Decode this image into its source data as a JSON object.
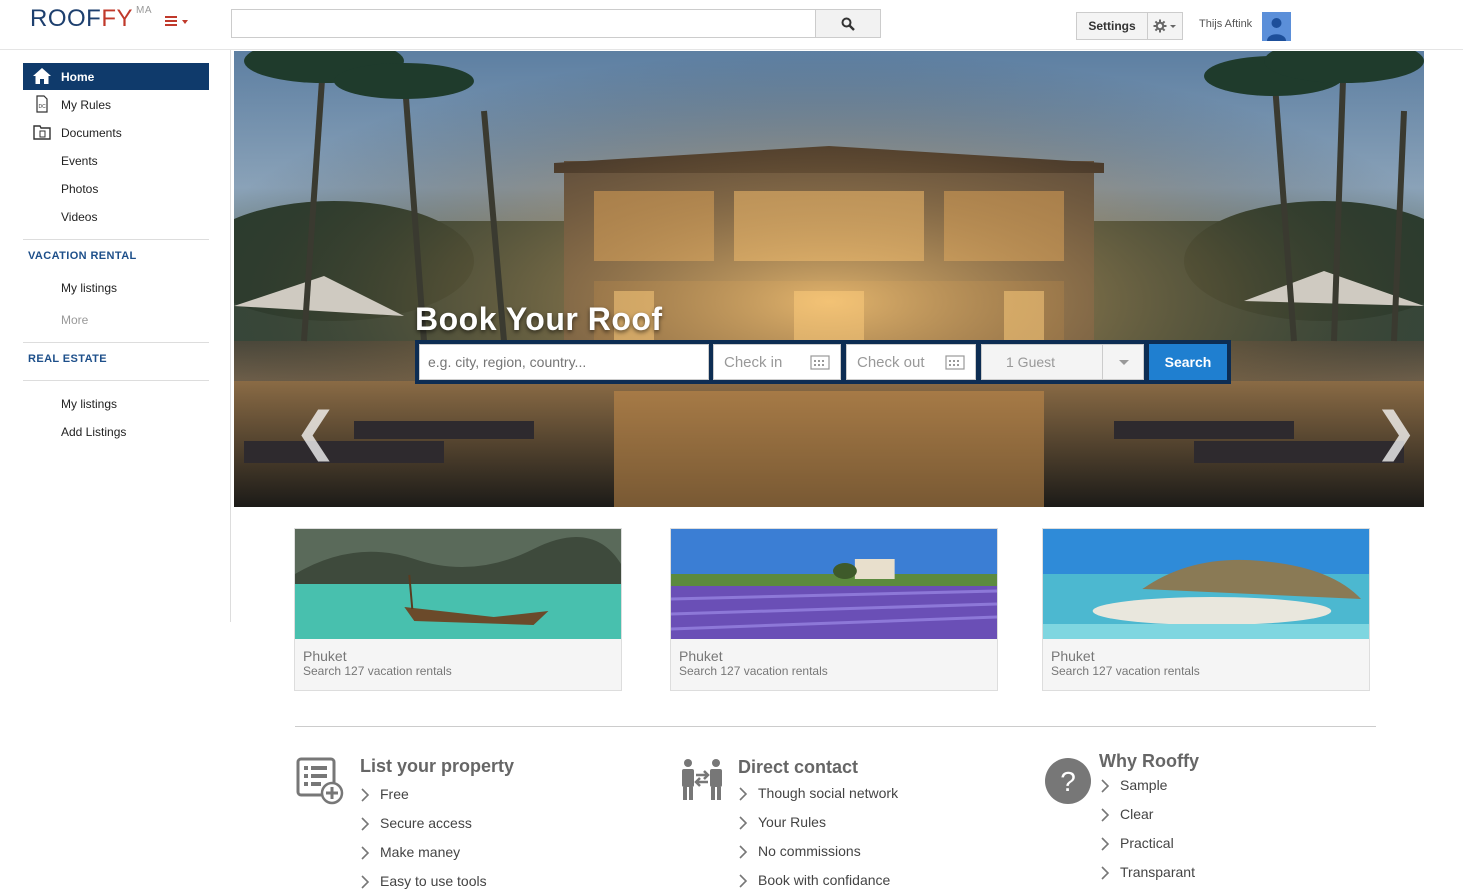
{
  "header": {
    "logo_part1": "ROOF",
    "logo_part2": "FY",
    "logo_suffix": "MA",
    "search_placeholder": "",
    "settings_label": "Settings",
    "user_name": "Thijs Aftink"
  },
  "sidebar": {
    "items": [
      {
        "label": "Home",
        "icon": "home-icon",
        "active": true
      },
      {
        "label": "My Rules",
        "icon": "document-icon"
      },
      {
        "label": "Documents",
        "icon": "folder-icon"
      },
      {
        "label": "Events"
      },
      {
        "label": "Photos"
      },
      {
        "label": "Videos"
      }
    ],
    "vacation_title": "VACATION RENTAL",
    "vacation_items": [
      "My listings",
      "More"
    ],
    "realestate_title": "REAL ESTATE",
    "realestate_items": [
      "My listings",
      "Add Listings"
    ]
  },
  "hero": {
    "title": "Book Your Roof",
    "destination_placeholder": "e.g. city, region, country...",
    "checkin_label": "Check in",
    "checkout_label": "Check out",
    "guests_label": "1 Guest",
    "search_label": "Search",
    "prev_arrow": "❮",
    "next_arrow": "❯"
  },
  "cards": [
    {
      "title": "Phuket",
      "subtitle": "Search 127 vacation rentals"
    },
    {
      "title": "Phuket",
      "subtitle": "Search 127 vacation rentals"
    },
    {
      "title": "Phuket",
      "subtitle": "Search 127 vacation rentals"
    }
  ],
  "features": [
    {
      "title": "List your property",
      "icon": "list-add-icon",
      "items": [
        "Free",
        "Secure access",
        "Make maney",
        "Easy to use tools"
      ]
    },
    {
      "title": "Direct contact",
      "icon": "people-exchange-icon",
      "items": [
        "Though social network",
        "Your Rules",
        "No commissions",
        "Book with confidance"
      ]
    },
    {
      "title": "Why Rooffy",
      "icon": "question-icon",
      "items": [
        "Sample",
        "Clear",
        "Practical",
        "Transparant"
      ]
    }
  ],
  "colors": {
    "brand_blue": "#1d3f6e",
    "brand_red": "#c0392b",
    "nav_active": "#0f3a6b",
    "search_button": "#1f7fd0"
  }
}
